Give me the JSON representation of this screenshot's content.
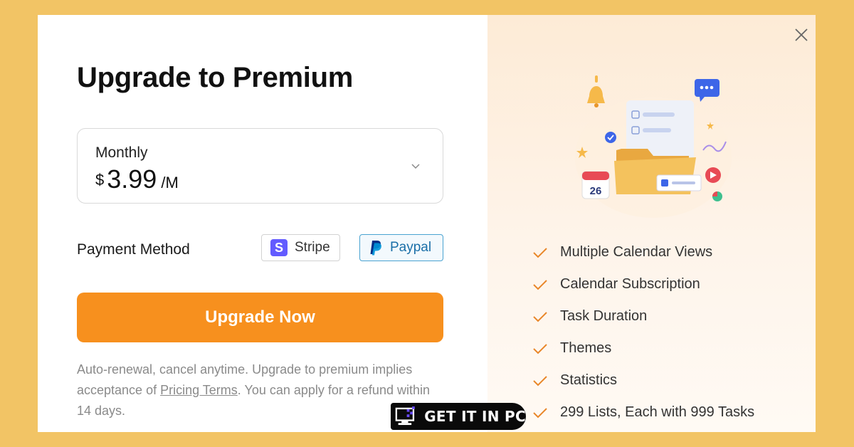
{
  "title": "Upgrade to Premium",
  "plan": {
    "name": "Monthly",
    "currency": "$",
    "amount": "3.99",
    "period": "/M"
  },
  "payment": {
    "label": "Payment Method",
    "options": [
      {
        "label": "Stripe",
        "selected": false
      },
      {
        "label": "Paypal",
        "selected": true
      }
    ]
  },
  "cta_label": "Upgrade Now",
  "terms": {
    "before": "Auto-renewal, cancel anytime. Upgrade to premium implies acceptance of ",
    "link": "Pricing Terms",
    "after": ". You can apply for a refund within 14 days."
  },
  "illustration": {
    "calendar_day": "26"
  },
  "features": [
    "Multiple Calendar Views",
    "Calendar Subscription",
    "Task Duration",
    "Themes",
    "Statistics",
    "299 Lists, Each with 999 Tasks"
  ],
  "watermark": "GET IT IN PC",
  "icons": [
    "close-icon",
    "chevron-down-icon",
    "stripe-logo-icon",
    "paypal-logo-icon",
    "check-icon"
  ],
  "colors": {
    "accent": "#f7901e",
    "check": "#e9872a",
    "paypal_border": "#4aa3d1",
    "stripe": "#635bff",
    "background": "#f2c465"
  }
}
